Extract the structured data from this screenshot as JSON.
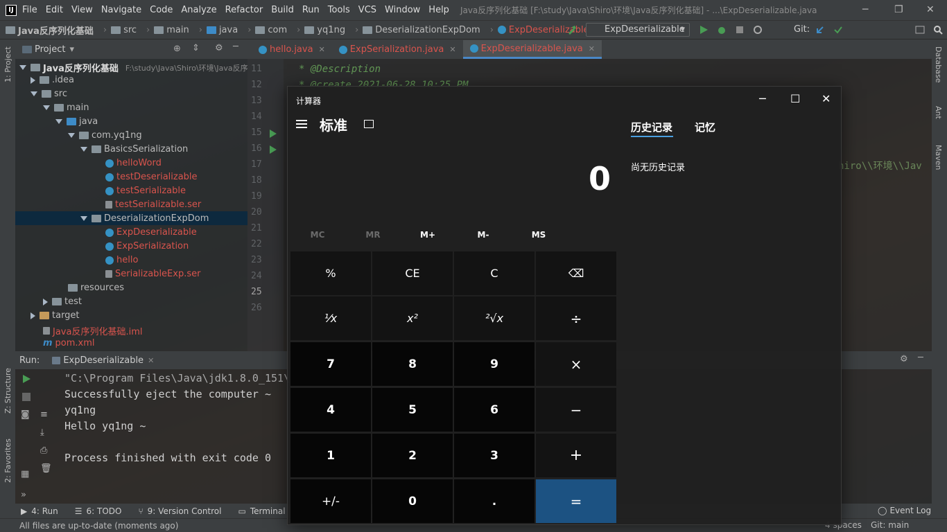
{
  "menubar": {
    "logo": "IJ",
    "items": [
      "File",
      "Edit",
      "View",
      "Navigate",
      "Code",
      "Analyze",
      "Refactor",
      "Build",
      "Run",
      "Tools",
      "VCS",
      "Window",
      "Help"
    ],
    "window_title": "Java反序列化基础 [F:\\study\\Java\\Shiro\\环境\\Java反序列化基础] - ...\\ExpDeserializable.java"
  },
  "breadcrumb": [
    "Java反序列化基础",
    "src",
    "main",
    "java",
    "com",
    "yq1ng",
    "DeserializationExpDom",
    "ExpDeserializable"
  ],
  "toolbar": {
    "run_config": "ExpDeserializable",
    "git_label": "Git:"
  },
  "left_strip": {
    "project": "1: Project",
    "structure": "Z: Structure",
    "favorites": "2: Favorites"
  },
  "right_strip": {
    "database": "Database",
    "ant": "Ant",
    "maven": "Maven"
  },
  "project": {
    "header": "Project",
    "root": "Java反序列化基础",
    "root_path": "F:\\study\\Java\\Shiro\\环境\\Java反序",
    "items": {
      "idea": ".idea",
      "src": "src",
      "main": "main",
      "java": "java",
      "pkg": "com.yq1ng",
      "basics": "BasicsSerialization",
      "helloWord": "helloWord",
      "testDeserializable": "testDeserializable",
      "testSerializable": "testSerializable",
      "testSerializableSer": "testSerializable.ser",
      "deser": "DeserializationExpDom",
      "expDeser": "ExpDeserializable",
      "expSer": "ExpSerialization",
      "hello": "hello",
      "serExp": "SerializableExp.ser",
      "resources": "resources",
      "test": "test",
      "target": "target",
      "iml": "Java反序列化基础.iml",
      "pom": "pom.xml"
    }
  },
  "editor": {
    "tabs": [
      "hello.java",
      "ExpSerialization.java",
      "ExpDeserializable.java"
    ],
    "line_numbers": [
      "11",
      "12",
      "13",
      "14",
      "15",
      "16",
      "17",
      "18",
      "19",
      "20",
      "21",
      "22",
      "23",
      "24",
      "25",
      "26"
    ],
    "code_line1": "* @Description",
    "code_line2": "* @create 2021-06-28 10:25 PM",
    "code_fragment": "hiro\\\\环境\\\\Jav"
  },
  "run": {
    "label": "Run:",
    "tab": "ExpDeserializable",
    "output": [
      "\"C:\\Program Files\\Java\\jdk1.8.0_151\\",
      "Successfully eject the computer ~",
      "yq1ng",
      "Hello yq1ng ~",
      "",
      "Process finished with exit code 0"
    ]
  },
  "bottom_tabs": [
    "4: Run",
    "6: TODO",
    "9: Version Control",
    "Terminal"
  ],
  "event_log": "Event Log",
  "status": {
    "message": "All files are up-to-date (moments ago)",
    "right": "4 spaces",
    "git": "Git: main"
  },
  "calculator": {
    "title": "计算器",
    "mode": "标准",
    "display": "0",
    "memory": [
      "MC",
      "MR",
      "M+",
      "M-",
      "MS"
    ],
    "keys": [
      [
        "%",
        "CE",
        "C",
        "⌫"
      ],
      [
        "¹⁄x",
        "x²",
        "²√x",
        "÷"
      ],
      [
        "7",
        "8",
        "9",
        "×"
      ],
      [
        "4",
        "5",
        "6",
        "−"
      ],
      [
        "1",
        "2",
        "3",
        "+"
      ],
      [
        "+/-",
        "0",
        ".",
        "="
      ]
    ],
    "history_tab": "历史记录",
    "memory_tab": "记忆",
    "no_history": "尚无历史记录",
    "accent": "#1c5282"
  }
}
